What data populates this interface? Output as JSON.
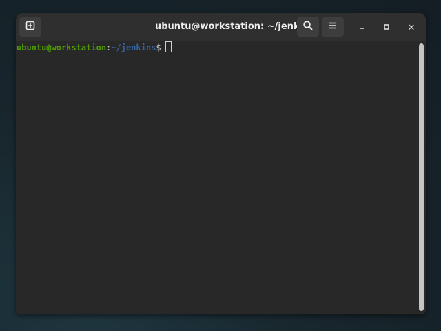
{
  "window": {
    "title": "ubuntu@workstation: ~/jenkins",
    "new_tab_icon": "new-tab-icon",
    "search_icon": "search-icon",
    "menu_icon": "hamburger-menu-icon",
    "minimize_icon": "minimize-icon",
    "maximize_icon": "maximize-icon",
    "close_icon": "close-icon",
    "close_glyph": "✕"
  },
  "terminal": {
    "prompt_user": "ubuntu@workstation",
    "prompt_sep": ":",
    "prompt_path": "~/jenkins",
    "prompt_symbol": "$",
    "input": ""
  },
  "colors": {
    "user": "#4e9a06",
    "path": "#3465a4",
    "background": "#282828",
    "titlebar": "#2f2f2f"
  }
}
